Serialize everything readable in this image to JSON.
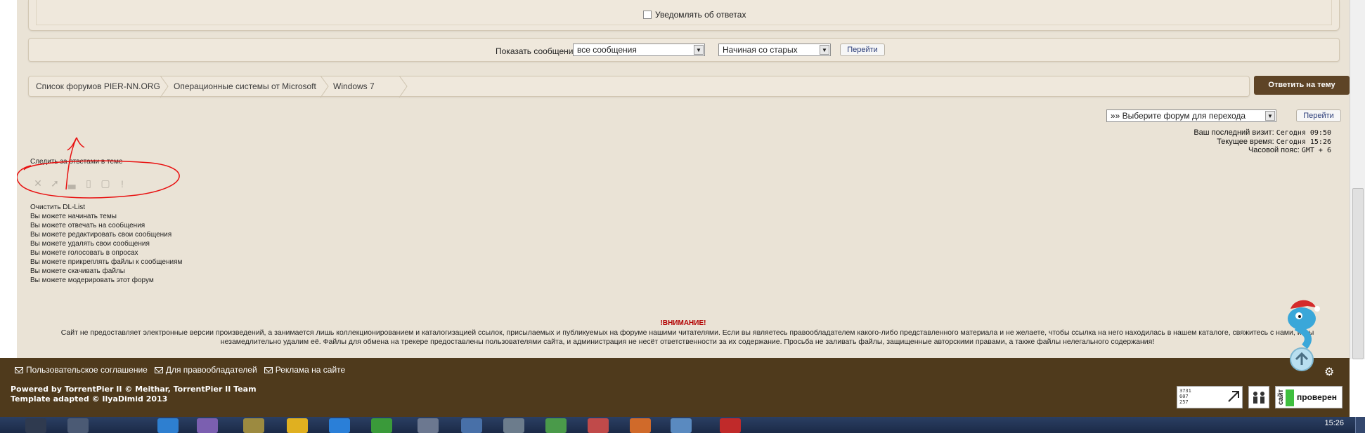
{
  "notify": {
    "label": "Уведомлять об ответах"
  },
  "show_messages": {
    "label": "Показать сообщения:",
    "filter_value": "все сообщения",
    "order_value": "Начиная со старых",
    "go_button": "Перейти"
  },
  "breadcrumb": [
    "Список форумов PIER-NN.ORG",
    "Операционные системы от Microsoft",
    "Windows 7"
  ],
  "reply_button": "Ответить на тему",
  "jump": {
    "select_value": "»» Выберите форум для перехода",
    "go_button": "Перейти"
  },
  "visit_info": {
    "last_visit_label": "Ваш последний визит:",
    "last_visit_value": "Сегодня 09:50",
    "current_time_label": "Текущее время:",
    "current_time_value": "Сегодня 15:26",
    "timezone_label": "Часовой пояс:",
    "timezone_value": "GMT + 6"
  },
  "watch_topic": "Следить за ответами в теме",
  "clear_dl": "Очистить DL-List",
  "permissions_prefix": "Вы можете",
  "permissions": [
    "начинать темы",
    "отвечать на сообщения",
    "редактировать свои сообщения",
    "удалять свои сообщения",
    "голосовать в опросах",
    "прикреплять файлы к сообщениям",
    "скачивать файлы",
    "модерировать этот форум"
  ],
  "warning": {
    "title": "!ВНИМАНИЕ!",
    "line1": "Сайт не предоставляет электронные версии произведений, а занимается лишь коллекционированием и каталогизацией ссылок, присылаемых и публикуемых на форуме нашими читателями. Если вы являетесь правообладателем какого-либо представленного материала и не желаете, чтобы ссылка на него находилась в нашем каталоге, свяжитесь с нами, и мы",
    "line2": "незамедлительно удалим её. Файлы для обмена на трекере предоставлены пользователями сайта, и администрация не несёт ответственности за их содержание. Просьба не заливать файлы, защищенные авторскими правами, а также файлы нелегального содержания!"
  },
  "footer": {
    "links": [
      "Пользовательское соглашение",
      "Для правообладателей",
      "Реклама на сайте"
    ],
    "powered_line1": "Powered by TorrentPier II © Meithar, TorrentPier II Team",
    "powered_line2": "Template adapted © IlyaDimid 2013",
    "counter_lines": [
      "3731",
      "607",
      "257"
    ],
    "badge_left": "сайт",
    "badge_right": "проверен"
  },
  "taskbar": {
    "clock": "15:26"
  },
  "colors": {
    "page_bg": "#eae3d6",
    "footer_bg": "#4f3a1c",
    "reply_btn": "#5e4426",
    "warning_red": "#b20000",
    "annotation_red": "#e81010"
  }
}
